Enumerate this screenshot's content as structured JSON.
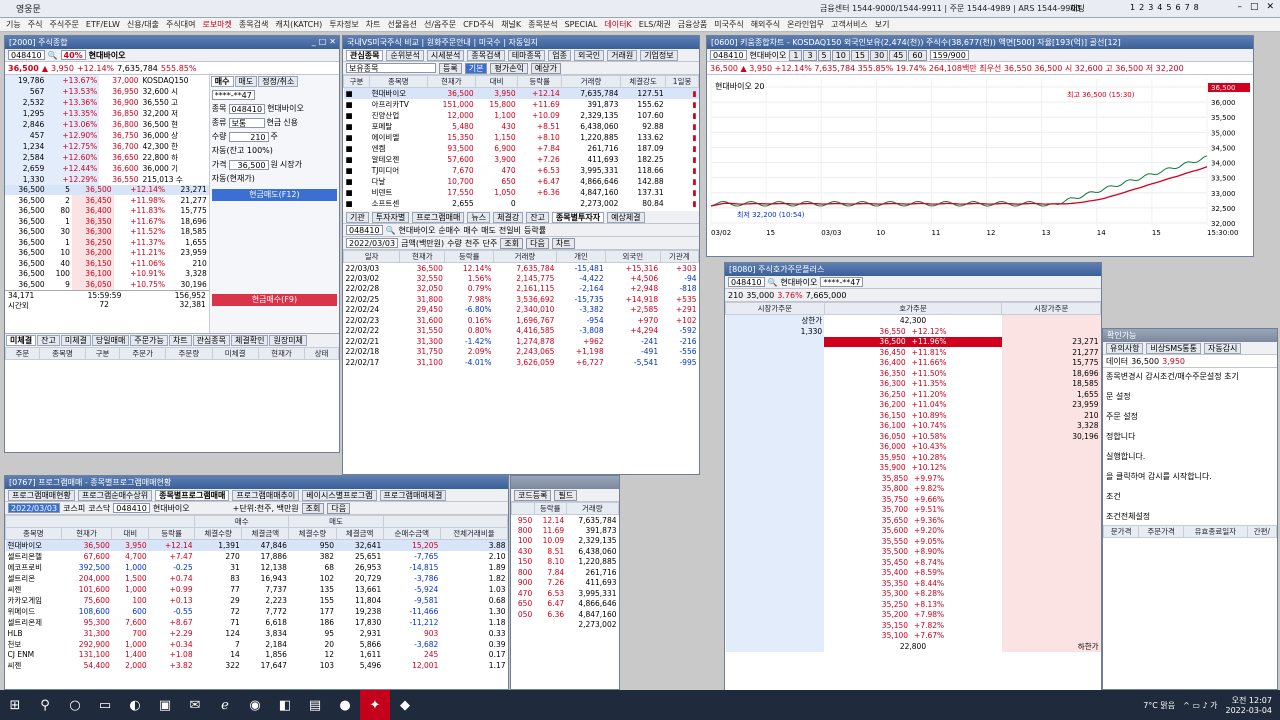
{
  "app": {
    "name": "영웅문",
    "center_info": "금융센터 1544-9000/1544-9911 | 주문 1544-4989 | ARS 1544-9900",
    "pages": [
      "1",
      "2",
      "3",
      "4",
      "5",
      "6",
      "7",
      "8"
    ],
    "ui_chat": "채팅"
  },
  "menu": [
    "기능",
    "주식",
    "주식주문",
    "ETF/ELW",
    "신용/대출",
    "주식대여",
    "로보마켓",
    "종목검색",
    "캐치(KATCH)",
    "투자정보",
    "차트",
    "선물옵션",
    "선/옵주문",
    "CFD주식",
    "채널K",
    "종목분석",
    "SPECIAL",
    "데이터K",
    "ELS/채권",
    "금융상품",
    "미국주식",
    "해외주식",
    "온라인업무",
    "고객서비스",
    "보기"
  ],
  "menu_highlight": [
    "로보마켓",
    "데이터K"
  ],
  "w2000": {
    "title": "[2000] 주식종합",
    "code": "048410",
    "name": "현대바이오",
    "badge": "40%",
    "price": "36,500",
    "change": "3,950",
    "rate": "+12.14%",
    "volume": "7,635,784",
    "vol_rate": "555.85%",
    "book_asks": [
      [
        "19,786",
        "+13.67%",
        "37,000"
      ],
      [
        "567",
        "+13.53%",
        "36,950"
      ],
      [
        "2,532",
        "+13.36%",
        "36,900"
      ],
      [
        "1,295",
        "+13.35%",
        "36,850"
      ],
      [
        "2,846",
        "+13.06%",
        "36,800"
      ],
      [
        "457",
        "+12.90%",
        "36,750"
      ],
      [
        "1,234",
        "+12.75%",
        "36,700"
      ],
      [
        "2,584",
        "+12.60%",
        "36,650"
      ],
      [
        "2,659",
        "+12.44%",
        "36,600"
      ],
      [
        "1,330",
        "+12.29%",
        "36,550"
      ]
    ],
    "book_bids": [
      [
        "36,500",
        "5",
        "",
        "36,500",
        "+12.14%",
        "23,271"
      ],
      [
        "36,500",
        "2",
        "",
        "36,450",
        "+11.98%",
        "21,277"
      ],
      [
        "36,500",
        "80",
        "",
        "36,400",
        "+11.83%",
        "15,775"
      ],
      [
        "36,500",
        "1",
        "",
        "36,350",
        "+11.67%",
        "18,696"
      ],
      [
        "36,500",
        "30",
        "",
        "36,300",
        "+11.52%",
        "18,585"
      ],
      [
        "36,500",
        "1",
        "",
        "36,250",
        "+11.37%",
        "1,655"
      ],
      [
        "36,500",
        "10",
        "",
        "36,200",
        "+11.21%",
        "23,959"
      ],
      [
        "36,500",
        "40",
        "",
        "36,150",
        "+11.06%",
        "210"
      ],
      [
        "36,500",
        "100",
        "",
        "36,100",
        "+10.91%",
        "3,328"
      ],
      [
        "36,500",
        "9",
        "",
        "36,050",
        "+10.75%",
        "30,196"
      ]
    ],
    "book_summary": [
      "34,171",
      "15:59:59",
      "156,952"
    ],
    "book_time_label": "시간외",
    "book_after": [
      "72",
      "32,381"
    ],
    "info": [
      "KOSDAQ150",
      "32,600 시",
      "36,550 고",
      "32,200 저",
      "36,500 현",
      "36,000 상",
      "42,300 한",
      "22,800 하",
      "36,000 기",
      "215,013 수",
      "3,950 +12.14"
    ],
    "order": {
      "tabs": [
        "매수",
        "매도",
        "정정/취소"
      ],
      "code": "048410",
      "name": "현대바이오",
      "type": "보통",
      "cash": "현금",
      "credit": "신용",
      "qty": "210",
      "qty_unit": "주",
      "price": "36,500",
      "price_unit": "원",
      "market": "시장가",
      "auto": "자동(잔고 100%)",
      "auto2": "자동(현재가)",
      "buy_btn": "현금매도(F12)",
      "buy_btn2": "현금매수(F9)",
      "account": "****-**47"
    },
    "bottom_tabs": [
      "미체결",
      "잔고",
      "미체결",
      "당일매매",
      "주문가능",
      "차트",
      "관심종목",
      "체결확인",
      "원장미체"
    ],
    "bottom_cols": [
      "주문",
      "종목명",
      "구분",
      "주문가",
      "주문량",
      "미체결",
      "현재가",
      "상태"
    ]
  },
  "interest": {
    "title": "국내VS미국주식 비교 | 원화주문안내 | 미국수 | 자동일지",
    "tabs": [
      "관심종목",
      "순위분석",
      "시세분석",
      "종목검색",
      "테마종목",
      "업종",
      "외국인",
      "거래원",
      "기업정보"
    ],
    "group": "보유종목",
    "btns": [
      "등록",
      "기본",
      "평가손익",
      "예상가"
    ],
    "cols": [
      "구분",
      "종목명",
      "현재가",
      "대비",
      "등락률",
      "거래량",
      "체결강도",
      "1일봉"
    ],
    "rows": [
      [
        "현대바이오",
        "36,500",
        "3,950",
        "+12.14",
        "7,635,784",
        "127.51"
      ],
      [
        "아프리카TV",
        "151,000",
        "15,800",
        "+11.69",
        "391,873",
        "155.62"
      ],
      [
        "진양산업",
        "12,000",
        "1,100",
        "+10.09",
        "2,329,135",
        "107.60"
      ],
      [
        "포메탈",
        "5,480",
        "430",
        "+8.51",
        "6,438,060",
        "92.88"
      ],
      [
        "에이비엘",
        "15,350",
        "1,150",
        "+8.10",
        "1,220,885",
        "133.62"
      ],
      [
        "엔켐",
        "93,500",
        "6,900",
        "+7.84",
        "261,716",
        "187.09"
      ],
      [
        "알테오젠",
        "57,600",
        "3,900",
        "+7.26",
        "411,693",
        "182.25"
      ],
      [
        "TJ미디어",
        "7,670",
        "470",
        "+6.53",
        "3,995,331",
        "118.66"
      ],
      [
        "다날",
        "10,700",
        "650",
        "+6.47",
        "4,866,646",
        "142.88"
      ],
      [
        "비덴트",
        "17,550",
        "1,050",
        "+6.36",
        "4,847,160",
        "137.31"
      ],
      [
        "소프트센",
        "2,655",
        "0",
        "",
        "2,273,002",
        "80.84"
      ]
    ],
    "sub_tabs": [
      "기관",
      "투자자별",
      "프로그램매매",
      "뉴스",
      "체결강",
      "잔고",
      "종목별투자자",
      "예상체결"
    ],
    "sub_code": "048410",
    "sub_name": "현대바이오",
    "sub_opts": [
      "순매수",
      "매수",
      "매도",
      "전일비",
      "등락률"
    ],
    "sub_date": "2022/03/03",
    "sub_opts2": [
      "금액(백만원)",
      "수량",
      "천주",
      "단주"
    ],
    "sub_btns": [
      "조회",
      "다음",
      "차트"
    ],
    "sub_cols": [
      "일자",
      "현재가",
      "등락률",
      "거래량",
      "개인",
      "외국인",
      "기관계"
    ],
    "sub_rows": [
      [
        "22/03/03",
        "36,500",
        "12.14%",
        "7,635,784",
        "-15,481",
        "+15,316",
        "+303"
      ],
      [
        "22/03/02",
        "32,550",
        "1.56%",
        "2,145,775",
        "-4,422",
        "+4,506",
        "-94"
      ],
      [
        "22/02/28",
        "32,050",
        "0.79%",
        "2,161,115",
        "-2,164",
        "+2,948",
        "-818"
      ],
      [
        "22/02/25",
        "31,800",
        "7.98%",
        "3,536,692",
        "-15,735",
        "+14,918",
        "+535"
      ],
      [
        "22/02/24",
        "29,450",
        "-6.80%",
        "2,340,010",
        "-3,382",
        "+2,585",
        "+291"
      ],
      [
        "22/02/23",
        "31,600",
        "0.16%",
        "1,696,767",
        "-954",
        "+970",
        "+102"
      ],
      [
        "22/02/22",
        "31,550",
        "0.80%",
        "4,416,585",
        "-3,808",
        "+4,294",
        "-592"
      ],
      [
        "22/02/21",
        "31,300",
        "-1.42%",
        "1,274,878",
        "+962",
        "-241",
        "-216"
      ],
      [
        "22/02/18",
        "31,750",
        "2.09%",
        "2,243,065",
        "+1,198",
        "-491",
        "-556"
      ],
      [
        "22/02/17",
        "31,100",
        "-4.01%",
        "3,626,059",
        "+6,727",
        "-5,541",
        "-995"
      ]
    ]
  },
  "chart": {
    "title": "[0600] 키움종합차트 - KOSDAQ150 외국인보유(2,474(천)) 주식수(38,677(천)) 액면[500] 자율[193(억)] 골선[12]",
    "code": "048410",
    "name": "현대바이오",
    "info": "36,500 ▲ 3,950 +12.14% 7,635,784 355.85% 19.74% 264,108백만 최우선 36,550 36,500 시 32,600 고 36,500 저 32,200",
    "legend": "현대바이오 20",
    "hi_label": "최고 36,500 (15:30)",
    "lo_label": "최저 32,200 (10:54)",
    "cur_tag": "36,500",
    "pct_tag": "11.81%",
    "pct_tag2": "-5.31%",
    "period": "159/900",
    "period_btns": [
      "1",
      "3",
      "5",
      "10",
      "15",
      "30",
      "45",
      "60"
    ],
    "yticks": [
      "36,500",
      "36,000",
      "35,500",
      "35,000",
      "34,500",
      "34,000",
      "33,500",
      "33,000",
      "32,500",
      "32,000"
    ],
    "xticks": [
      "03/02",
      "15",
      "03/03",
      "10",
      "11",
      "12",
      "13",
      "14",
      "15",
      "15:30:00"
    ]
  },
  "hoga": {
    "title": "[8080] 주식호가주문플러스",
    "code": "048410",
    "name": "현대바이오",
    "price": "210",
    "cur": "35,000",
    "rate": "3.76%",
    "vol": "7,665,000",
    "account": "****-**47",
    "cols": [
      "시장가주문",
      "호가주문",
      "시장가주문"
    ],
    "upper": "상한가",
    "upper_px": "42,300",
    "lower": "하한가",
    "lower_px": "22,800",
    "rows": [
      [
        "1,330",
        "36,550",
        "+12.12%",
        ""
      ],
      [
        "",
        "36,500",
        "+11.96%",
        "23,271"
      ],
      [
        "",
        "36,450",
        "+11.81%",
        "21,277"
      ],
      [
        "",
        "36,400",
        "+11.66%",
        "15,775"
      ],
      [
        "",
        "36,350",
        "+11.50%",
        "18,696"
      ],
      [
        "",
        "36,300",
        "+11.35%",
        "18,585"
      ],
      [
        "",
        "36,250",
        "+11.20%",
        "1,655"
      ],
      [
        "",
        "36,200",
        "+11.04%",
        "23,959"
      ],
      [
        "",
        "36,150",
        "+10.89%",
        "210"
      ],
      [
        "",
        "36,100",
        "+10.74%",
        "3,328"
      ],
      [
        "",
        "36,050",
        "+10.58%",
        "30,196"
      ],
      [
        "",
        "36,000",
        "+10.43%",
        ""
      ],
      [
        "",
        "35,950",
        "+10.28%",
        ""
      ],
      [
        "",
        "35,900",
        "+10.12%",
        ""
      ],
      [
        "",
        "35,850",
        "+9.97%",
        ""
      ],
      [
        "",
        "35,800",
        "+9.82%",
        ""
      ],
      [
        "",
        "35,750",
        "+9.66%",
        ""
      ],
      [
        "",
        "35,700",
        "+9.51%",
        ""
      ],
      [
        "",
        "35,650",
        "+9.36%",
        ""
      ],
      [
        "",
        "35,600",
        "+9.20%",
        ""
      ],
      [
        "",
        "35,550",
        "+9.05%",
        ""
      ],
      [
        "",
        "35,500",
        "+8.90%",
        ""
      ],
      [
        "",
        "35,450",
        "+8.74%",
        ""
      ],
      [
        "",
        "35,400",
        "+8.59%",
        ""
      ],
      [
        "",
        "35,350",
        "+8.44%",
        ""
      ],
      [
        "",
        "35,300",
        "+8.28%",
        ""
      ],
      [
        "",
        "35,250",
        "+8.13%",
        ""
      ],
      [
        "",
        "35,200",
        "+7.98%",
        ""
      ],
      [
        "",
        "35,150",
        "+7.82%",
        ""
      ],
      [
        "",
        "35,100",
        "+7.67%",
        ""
      ]
    ],
    "footer": [
      "34,171",
      "15:59:59",
      "+122,781",
      "156,952"
    ],
    "tabs": [
      "주",
      "210",
      "주문",
      "매수",
      "매도"
    ]
  },
  "program": {
    "title": "[0767] 프로그램매매 - 종목별프로그램매매현황",
    "tabs": [
      "프로그램매매현황",
      "프로그램순매수상위",
      "종목별프로그램매매",
      "프로그램매매추이",
      "베이시스별프로그램",
      "프로그램매매체결"
    ],
    "date": "2022/03/03",
    "markets": [
      "코스피",
      "코스닥"
    ],
    "code": "048410",
    "name": "현대바이오",
    "unit": "+단위:천주, 백만원",
    "btns": [
      "조회",
      "다음"
    ],
    "cols": [
      "종목명",
      "현재가",
      "대비",
      "등락률",
      "체결수량",
      "체결금액",
      "체결수량",
      "체결금액",
      "순매수금액",
      "전체거래비율"
    ],
    "rows": [
      [
        "현대바이오",
        "36,500",
        "3,950",
        "+12.14",
        "1,391",
        "47,846",
        "950",
        "32,641",
        "15,205",
        "3.88"
      ],
      [
        "셀트리온헬",
        "67,600",
        "4,700",
        "+7.47",
        "270",
        "17,886",
        "382",
        "25,651",
        "-7,765",
        "2.10"
      ],
      [
        "에코프로비",
        "392,500",
        "1,000",
        "-0.25",
        "31",
        "12,138",
        "68",
        "26,953",
        "-14,815",
        "1.89"
      ],
      [
        "셀트리온",
        "204,000",
        "1,500",
        "+0.74",
        "83",
        "16,943",
        "102",
        "20,729",
        "-3,786",
        "1.82"
      ],
      [
        "씨젠",
        "101,600",
        "1,000",
        "+0.99",
        "77",
        "7,737",
        "135",
        "13,661",
        "-5,924",
        "1.03"
      ],
      [
        "카카오게임",
        "75,600",
        "100",
        "+0.13",
        "29",
        "2,223",
        "155",
        "11,804",
        "-9,581",
        "0.68"
      ],
      [
        "위메이드",
        "108,600",
        "600",
        "-0.55",
        "72",
        "7,772",
        "177",
        "19,238",
        "-11,466",
        "1.30"
      ],
      [
        "셀트리온제",
        "95,300",
        "7,600",
        "+8.67",
        "71",
        "6,618",
        "186",
        "17,830",
        "-11,212",
        "1.18"
      ],
      [
        "HLB",
        "31,300",
        "700",
        "+2.29",
        "124",
        "3,834",
        "95",
        "2,931",
        "903",
        "0.33"
      ],
      [
        "천보",
        "292,900",
        "1,000",
        "+0.34",
        "7",
        "2,184",
        "20",
        "5,866",
        "-3,682",
        "0.39"
      ],
      [
        "CJ ENM",
        "131,100",
        "1,400",
        "+1.08",
        "14",
        "1,856",
        "12",
        "1,611",
        "245",
        "0.17"
      ],
      [
        "씨젠",
        "54,400",
        "2,000",
        "+3.82",
        "322",
        "17,647",
        "103",
        "5,496",
        "12,001",
        "1.17"
      ]
    ],
    "grp_buy": "매수",
    "grp_sell": "매도"
  },
  "small": {
    "cols": [
      "등락률",
      "거래량"
    ],
    "rows": [
      [
        "950",
        "12.14",
        "7,635,784"
      ],
      [
        "800",
        "11.69",
        "391,873"
      ],
      [
        "100",
        "10.09",
        "2,329,135"
      ],
      [
        "430",
        "8.51",
        "6,438,060"
      ],
      [
        "150",
        "8.10",
        "1,220,885"
      ],
      [
        "800",
        "7.84",
        "261,716"
      ],
      [
        "900",
        "7.26",
        "411,693"
      ],
      [
        "470",
        "6.53",
        "3,995,331"
      ],
      [
        "650",
        "6.47",
        "4,866,646"
      ],
      [
        "050",
        "6.36",
        "4,847,160"
      ],
      [
        "",
        "",
        "2,273,002"
      ]
    ],
    "label": "코드등록",
    "btn": "필드"
  },
  "right_panel": {
    "title": "확인가능",
    "tags": [
      "유의사항",
      "비상SMS통통",
      "자동감시"
    ],
    "name": "데이터",
    "price": "36,500",
    "chg": "3,950",
    "lines": [
      "종목변경시 감시조건/매수주문설정 초기",
      "문 설정",
      "주문 설정",
      "정합니다",
      "실행합니다.",
      "을 클릭하여 감시를 시작합니다.",
      "조건",
      "조건전체설정"
    ],
    "cols": [
      "문가격",
      "주문가격",
      "유효종료일자",
      "간편/"
    ]
  },
  "taskbar": {
    "weather": "7°C 맑음",
    "time": "오전 12:07",
    "date": "2022-03-04"
  }
}
